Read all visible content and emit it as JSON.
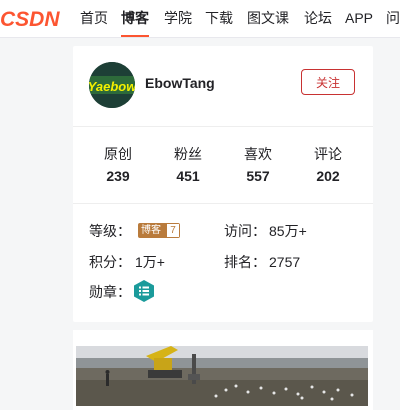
{
  "nav": {
    "logo_text": "CSDN",
    "items": [
      "首页",
      "博客",
      "学院",
      "下载",
      "图文课",
      "论坛",
      "APP",
      "问"
    ],
    "active": "博客"
  },
  "profile": {
    "username": "EbowTang",
    "avatar_text": "Yaebow",
    "follow_label": "关注",
    "stats": [
      {
        "label": "原创",
        "value": "239"
      },
      {
        "label": "粉丝",
        "value": "451"
      },
      {
        "label": "喜欢",
        "value": "557"
      },
      {
        "label": "评论",
        "value": "202"
      }
    ],
    "level_label": "等级：",
    "level_badge_text": "博客",
    "level_badge_num": "7",
    "visits_label": "访问：",
    "visits_value": "85万+",
    "points_label": "积分：",
    "points_value": "1万+",
    "rank_label": "排名：",
    "rank_value": "2757",
    "medals_label": "勋章："
  },
  "colors": {
    "brand_red": "#fc5531",
    "follow_red": "#c83232",
    "badge_brown": "#b97b3c",
    "medal_teal": "#1b9b9b"
  }
}
